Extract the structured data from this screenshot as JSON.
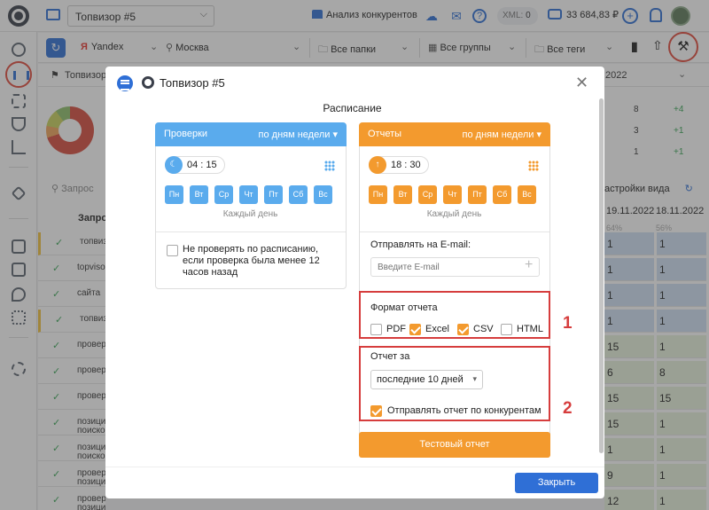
{
  "topbar": {
    "project": "Топвизор #5",
    "competitors_link": "Анализ конкурентов",
    "xml_label": "XML:",
    "xml_value": "0",
    "balance": "33 684,83 ₽"
  },
  "filters": {
    "engine": "Yandex",
    "region": "Москва",
    "folders": "Все папки",
    "groups": "Все группы",
    "tags": "Все теги"
  },
  "subbar": {
    "project_short": "Топвизор",
    "date": "2022"
  },
  "background": {
    "search_placeholder": "Запрос",
    "col_query": "Запро",
    "settings_view": "астройки вида",
    "rows": [
      "топвизор",
      "topvisor",
      "сайта",
      "топвизор",
      "провер",
      "провер",
      "провер",
      "позици поиско",
      "позици поиско",
      "провер позици",
      "проверка позиции"
    ],
    "right_top": [
      {
        "a": "8",
        "b": "+4"
      },
      {
        "a": "3",
        "b": "+1"
      },
      {
        "a": "1",
        "b": "+1"
      }
    ],
    "right_cols": [
      "19.11.2022",
      "18.11.2022"
    ],
    "right_sub": [
      "64%",
      "56%"
    ],
    "right_cells": [
      [
        "1",
        "1"
      ],
      [
        "1",
        "1"
      ],
      [
        "1",
        "1"
      ],
      [
        "1",
        "1"
      ],
      [
        "15",
        "1"
      ],
      [
        "6",
        "8"
      ],
      [
        "15",
        "15"
      ],
      [
        "15",
        "1"
      ],
      [
        "1",
        "1"
      ],
      [
        "9",
        "1"
      ],
      [
        "12",
        "1"
      ]
    ]
  },
  "modal": {
    "title": "Топвизор #5",
    "section_title": "Расписание",
    "checks": {
      "header": "Проверки",
      "mode": "по дням недели",
      "time": "04 : 15",
      "days": [
        "Пн",
        "Вт",
        "Ср",
        "Чт",
        "Пт",
        "Сб",
        "Вс"
      ],
      "every_day": "Каждый день",
      "skip_label": "Не проверять по расписанию, если проверка была менее 12 часов назад"
    },
    "reports": {
      "header": "Отчеты",
      "mode": "по дням недели",
      "time": "18 : 30",
      "days": [
        "Пн",
        "Вт",
        "Ср",
        "Чт",
        "Пт",
        "Сб",
        "Вс"
      ],
      "every_day": "Каждый день",
      "email_label": "Отправлять на E-mail:",
      "email_placeholder": "Введите E-mail",
      "format_title": "Формат отчета",
      "formats": [
        {
          "label": "PDF",
          "checked": false
        },
        {
          "label": "Excel",
          "checked": true
        },
        {
          "label": "CSV",
          "checked": true
        },
        {
          "label": "HTML",
          "checked": false
        }
      ],
      "period_title": "Отчет за",
      "period_value": "последние 10 дней",
      "competitors_label": "Отправлять отчет по конкурентам",
      "test_button": "Тестовый отчет"
    },
    "annotations": [
      "1",
      "2"
    ],
    "close_button": "Закрыть"
  },
  "colors": {
    "checks_accent": "#5aabed",
    "reports_accent": "#f39a2e",
    "primary": "#2f6fd6",
    "annotation": "#d63d3d"
  }
}
